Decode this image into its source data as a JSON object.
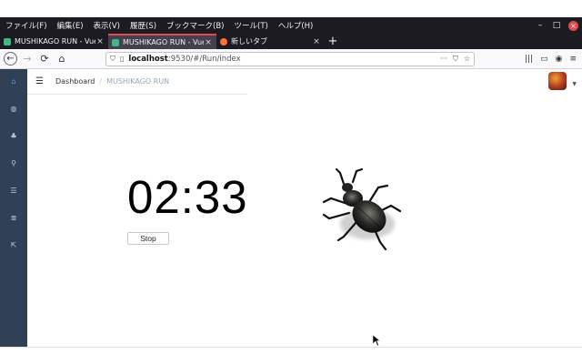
{
  "menubar": {
    "items": [
      "ファイル(F)",
      "編集(E)",
      "表示(V)",
      "履歴(S)",
      "ブックマーク(B)",
      "ツール(T)",
      "ヘルプ(H)"
    ],
    "window_controls": [
      "–",
      "□",
      "×"
    ]
  },
  "tabs": [
    {
      "label": "MUSHIKAGO RUN - Vue",
      "close": "×",
      "icon_color": "#41b883",
      "active": false
    },
    {
      "label": "MUSHIKAGO RUN - Vue",
      "close": "×",
      "icon_color": "#41b883",
      "active": true
    },
    {
      "label": "新しいタブ",
      "close": "×",
      "icon_color": "#ff7139",
      "active": false
    }
  ],
  "new_tab_label": "+",
  "address": {
    "host": "localhost",
    "rest": ":9530/#/Run/index",
    "url_right_icons": [
      "···",
      "⛉",
      "☆"
    ]
  },
  "breadcrumb": {
    "home": "Dashboard",
    "separator": "/",
    "current": "MUSHIKAGO RUN"
  },
  "run": {
    "timer": "02:33",
    "stop_label": "Stop"
  },
  "sidebar_icons": [
    "home-icon",
    "dashboard-icon",
    "sitemap-icon",
    "search-icon",
    "list-icon",
    "document-list-icon",
    "external-link-icon"
  ],
  "colors": {
    "sidebar": "#304156",
    "chrome": "#1c1b22",
    "active_tab_accent": "#e5484d"
  }
}
